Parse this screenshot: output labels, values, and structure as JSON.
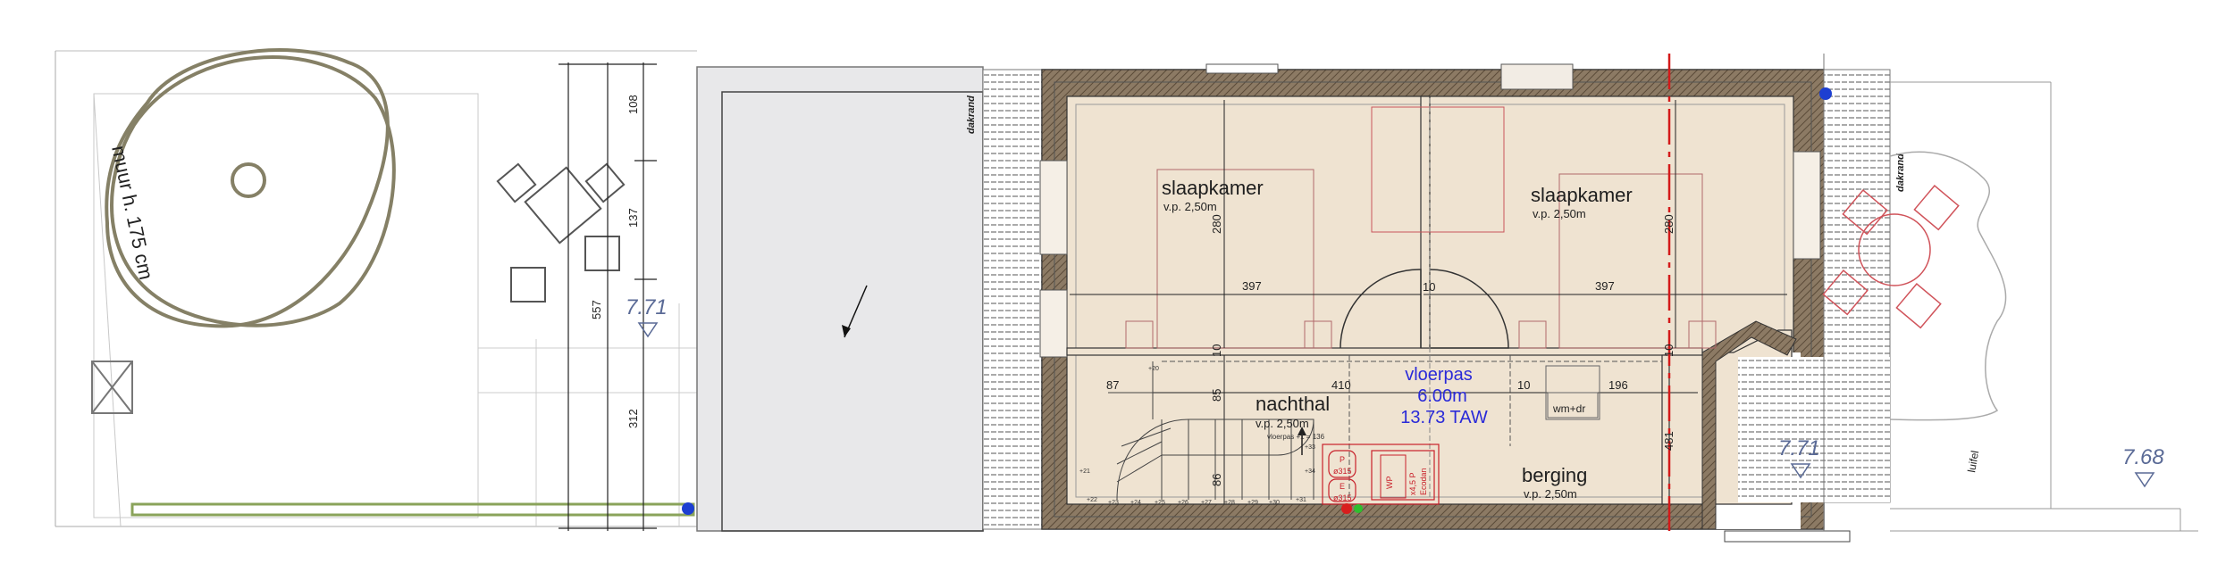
{
  "rooms": {
    "slaapkamer_left": {
      "name": "slaapkamer",
      "height": "v.p. 2,50m"
    },
    "slaapkamer_right": {
      "name": "slaapkamer",
      "height": "v.p. 2,50m"
    },
    "nachthal": {
      "name": "nachthal",
      "height": "v.p. 2,50m"
    },
    "berging": {
      "name": "berging",
      "height": "v.p. 2,50m"
    }
  },
  "floor_level": {
    "label": "vloerpas",
    "height": "6.00m",
    "taw": "13.73 TAW"
  },
  "levels": {
    "left": "7.71",
    "right": "7.71",
    "far_right": "7.68"
  },
  "dimensions": {
    "width_left_room": "397",
    "width_right_room": "397",
    "depth_left": "280",
    "depth_right": "280",
    "hall_width": "410",
    "hall_left": "87",
    "hall_right": "196",
    "hall_depth": "85",
    "stair_depth": "86",
    "wall_10a": "10",
    "wall_10b": "10",
    "wall_10c": "10",
    "wall_10d": "10",
    "overall": "557",
    "seg_top": "108",
    "seg_mid": "137",
    "seg_bottom": "312",
    "storage_depth": "481"
  },
  "annotations": {
    "wall_note": "muur h. 175 cm",
    "roof_edge_left": "dakrand",
    "roof_edge_right": "dakrand",
    "washer": "wm+dr",
    "heat_pump": "WP",
    "boiler_p": "P",
    "boiler_e": "E",
    "dia_top": "ø315",
    "dia_bottom": "ø315",
    "luifel": "luifel",
    "stair_note": "vloerpas +1 = 136",
    "wp_small": "x4,5 P",
    "wp_small2": "Ecodan"
  },
  "stairs": {
    "steps_left": [
      "+21",
      "+22",
      "+23",
      "+24",
      "+25",
      "+26",
      "+27",
      "+28",
      "+29",
      "+30",
      "+31"
    ],
    "steps_right": [
      "+33",
      "+34"
    ],
    "top_step": "+20"
  },
  "colors": {
    "floor": "#efe3d1",
    "wall": "#7a6a58",
    "tree": "#858066",
    "red_furniture": "#d0535a",
    "level_text": "#5a6a96",
    "blue_text": "#2a2ad8",
    "axis_red": "#d41a1a"
  },
  "icons": [
    "north-arrow-icon",
    "level-marker-icon",
    "tree-symbol-icon",
    "table-chairs-icon"
  ]
}
